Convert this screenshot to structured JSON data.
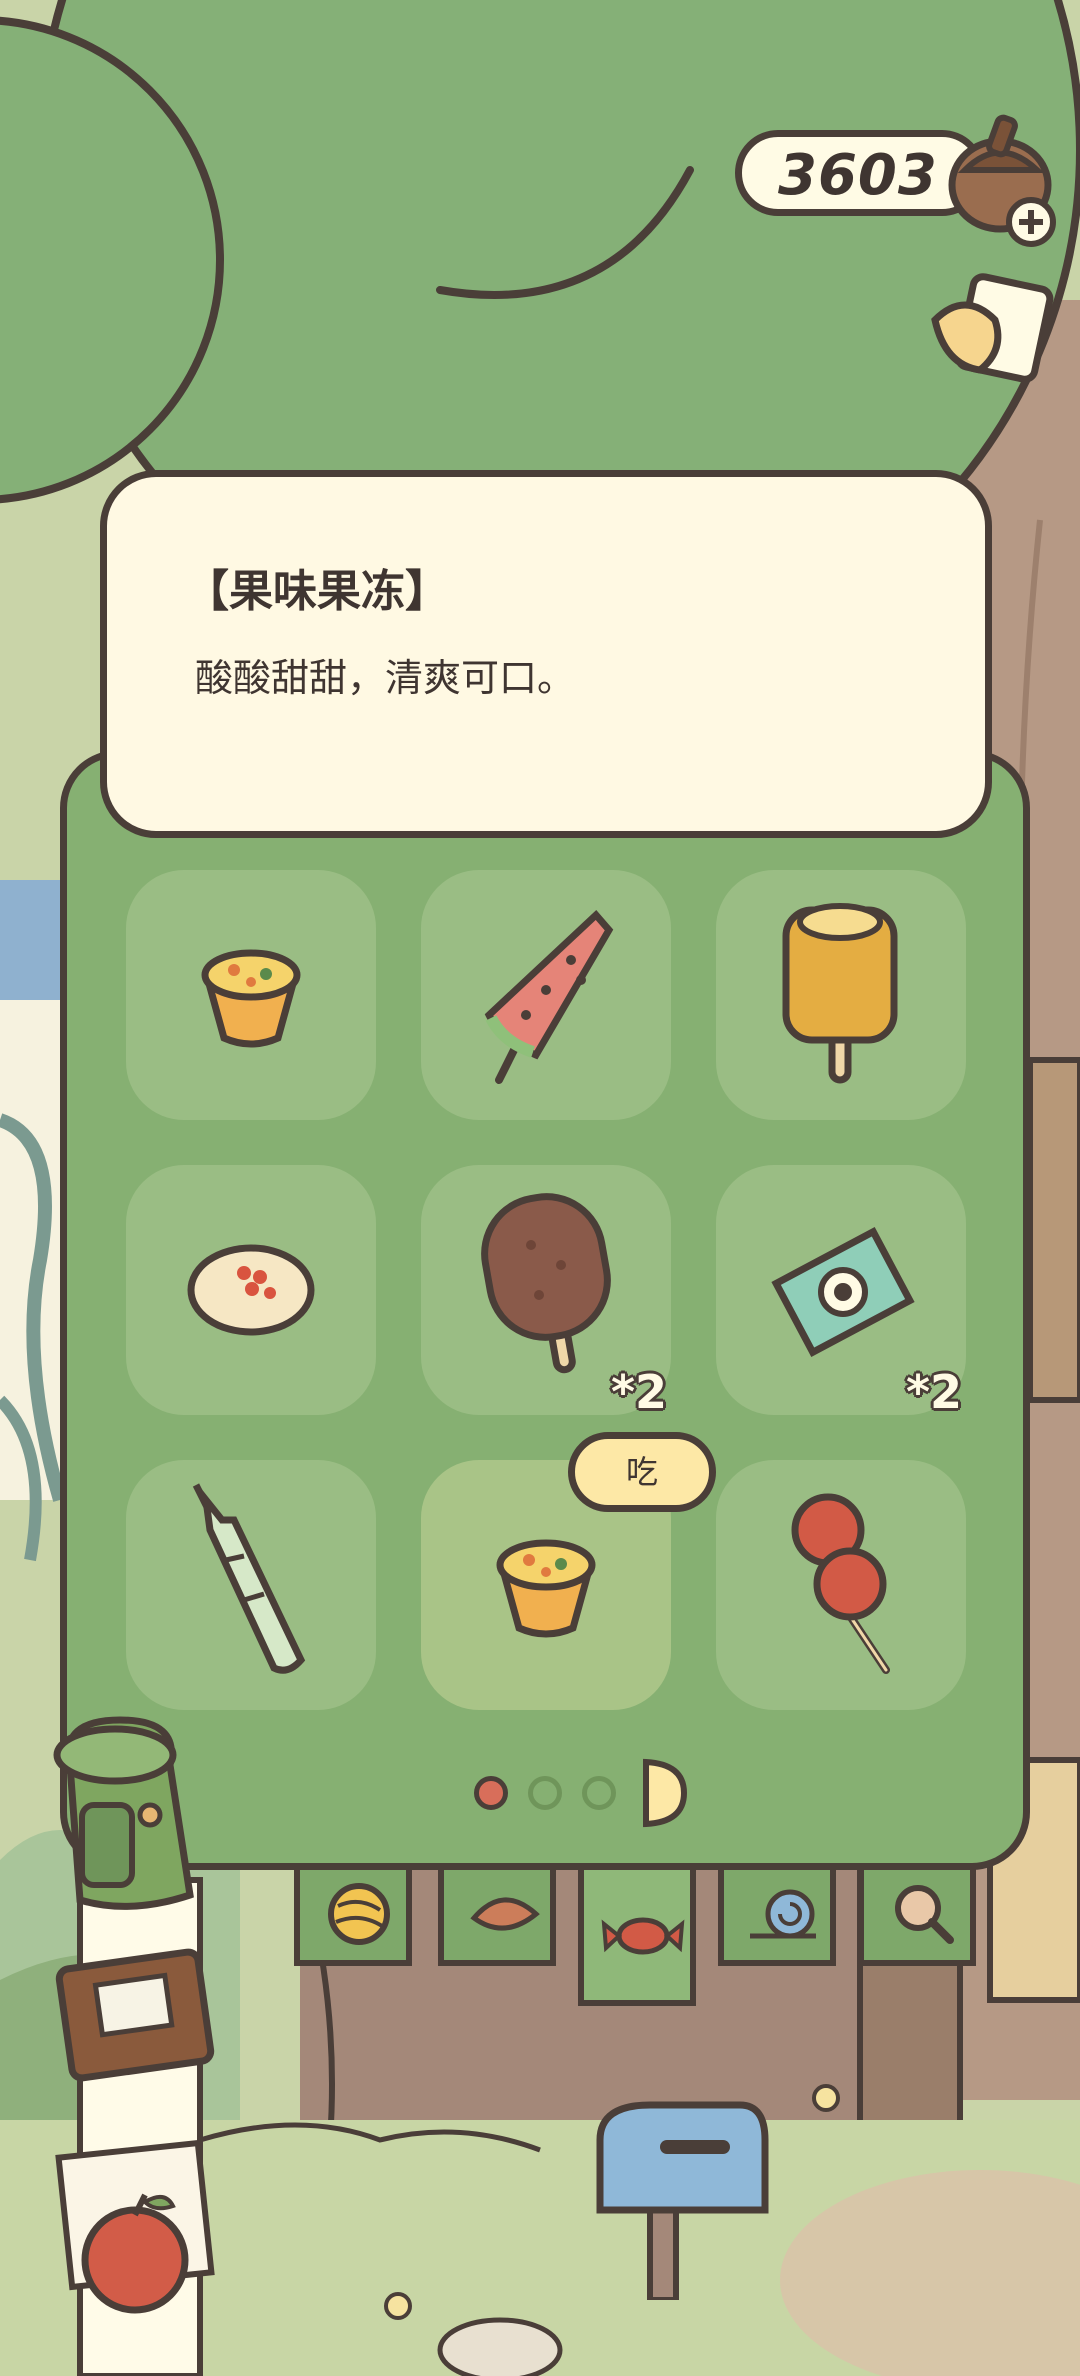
{
  "currency": {
    "amount": "3603",
    "icon": "acorn-icon",
    "add_icon": "plus-icon"
  },
  "top_right": {
    "icon": "card-album-icon"
  },
  "item_detail": {
    "title": "【果味果冻】",
    "description": "酸酸甜甜，清爽可口。"
  },
  "inventory": {
    "items": [
      {
        "icon": "fruit-jelly-icon",
        "count": ""
      },
      {
        "icon": "watermelon-popsicle-icon",
        "count": ""
      },
      {
        "icon": "orange-popsicle-icon",
        "count": ""
      },
      {
        "icon": "bun-icon",
        "count": ""
      },
      {
        "icon": "chocolate-popsicle-icon",
        "count": "*2"
      },
      {
        "icon": "candy-icon",
        "count": "*2"
      },
      {
        "icon": "dango-skewer-icon",
        "count": ""
      },
      {
        "icon": "fruit-jelly-icon",
        "count": "",
        "selected": true
      },
      {
        "icon": "candied-hawthorn-icon",
        "count": ""
      }
    ],
    "eat_button": "吃",
    "pagination": {
      "current": 1,
      "total": 3,
      "next_icon": "next-page-icon"
    }
  },
  "tabs": [
    {
      "icon": "yarn-ball-icon"
    },
    {
      "icon": "leaf-icon"
    },
    {
      "icon": "candy-icon",
      "active": true
    },
    {
      "icon": "snail-icon"
    },
    {
      "icon": "magnifier-icon"
    }
  ],
  "scene_icons": [
    "backpack-icon",
    "notebook-icon",
    "apple-icon",
    "mailbox-icon"
  ],
  "colors": {
    "panel": "#86b072",
    "outline": "#4a3e38",
    "card": "#fff9e3",
    "button": "#fde8a6"
  }
}
